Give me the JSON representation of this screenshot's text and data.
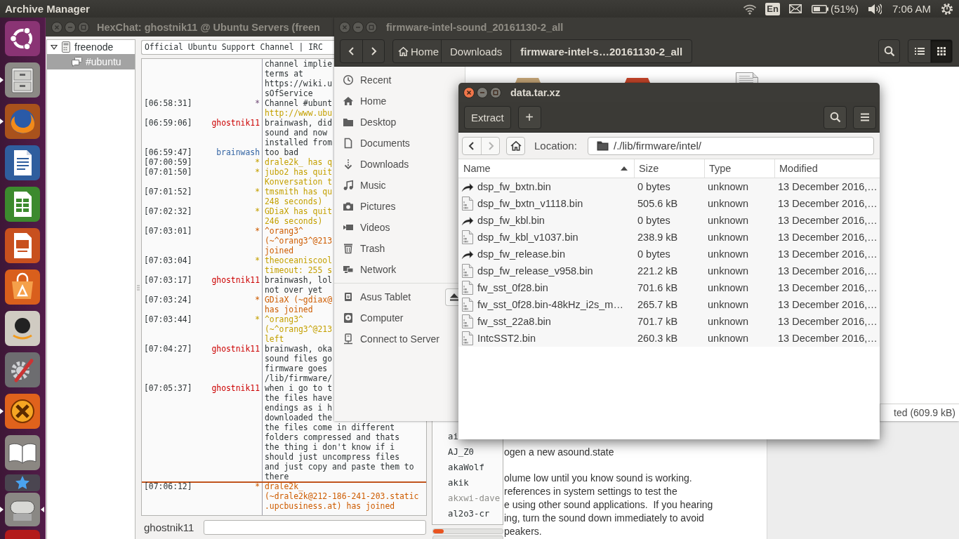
{
  "top_panel": {
    "app_name": "Archive Manager",
    "keyboard_layout": "En",
    "battery": "(51%)",
    "clock": "7:06 AM"
  },
  "launcher": {
    "items": [
      {
        "kind": "dash",
        "running": false,
        "focused": false
      },
      {
        "kind": "files",
        "running": true,
        "focused": false
      },
      {
        "kind": "browser",
        "running": true,
        "focused": false
      },
      {
        "kind": "writer",
        "running": false,
        "focused": false
      },
      {
        "kind": "calc",
        "running": false,
        "focused": false
      },
      {
        "kind": "impress",
        "running": false,
        "focused": false
      },
      {
        "kind": "store",
        "running": false,
        "focused": false
      },
      {
        "kind": "shop",
        "running": false,
        "focused": false
      },
      {
        "kind": "settings",
        "running": false,
        "focused": false
      },
      {
        "kind": "chat",
        "running": true,
        "focused": false
      },
      {
        "kind": "reader",
        "running": false,
        "focused": false
      },
      {
        "kind": "star",
        "running": false,
        "focused": false
      },
      {
        "kind": "roller",
        "running": true,
        "focused": true
      },
      {
        "kind": "red",
        "running": false,
        "focused": false
      }
    ]
  },
  "hexchat": {
    "active": false,
    "title": "HexChat: ghostnik11 @ Ubuntu Servers (freen",
    "tree": [
      {
        "label": "freenode",
        "expanded": true,
        "selected": false,
        "children": [
          {
            "label": "#ubuntu",
            "selected": true
          }
        ]
      }
    ],
    "topic": "Official Ubuntu Support Channel | IRC",
    "messages": [
      {
        "kind": "text",
        "lines": [
          "channel implie",
          "terms at",
          "https://wiki.u",
          "sOfService"
        ]
      },
      {
        "time": "[06:58:31]",
        "nick": "*",
        "kind": "topic",
        "lines": [
          "Channel #ubunt"
        ]
      },
      {
        "kind": "link",
        "lines": [
          "http://www.ubu"
        ]
      },
      {
        "time": "[06:59:06]",
        "nick": "ghostnik11",
        "color": "#cc0000",
        "kind": "text",
        "lines": [
          "brainwash, did",
          "sound and now",
          "installed from"
        ]
      },
      {
        "time": "[06:59:47]",
        "nick": "brainwash",
        "color": "#3465a4",
        "kind": "text",
        "lines": [
          "too bad"
        ]
      },
      {
        "time": "[07:00:59]",
        "nick": "*",
        "kind": "quit",
        "lines": [
          "drale2k_ has q"
        ]
      },
      {
        "time": "[07:01:50]",
        "nick": "*",
        "kind": "quit",
        "lines": [
          "jubo2 has quit",
          "Konversation t"
        ]
      },
      {
        "time": "[07:01:52]",
        "nick": "*",
        "kind": "quit",
        "lines": [
          "tmsmith has qu",
          "248 seconds)"
        ]
      },
      {
        "time": "[07:02:32]",
        "nick": "*",
        "kind": "quit",
        "lines": [
          "GDiaX has quit",
          "246 seconds)"
        ]
      },
      {
        "time": "[07:03:01]",
        "nick": "*",
        "kind": "join",
        "lines": [
          "^orang3^",
          "(~^orang3^@213",
          "joined"
        ]
      },
      {
        "time": "[07:03:04]",
        "nick": "*",
        "kind": "quit",
        "lines": [
          "theoceaniscool",
          "timeout: 255 s"
        ]
      },
      {
        "time": "[07:03:17]",
        "nick": "ghostnik11",
        "color": "#cc0000",
        "kind": "text",
        "lines": [
          "brainwash, lol",
          "not over yet"
        ]
      },
      {
        "time": "[07:03:24]",
        "nick": "*",
        "kind": "join",
        "lines": [
          "GDiaX (~gdiax@",
          "has joined"
        ]
      },
      {
        "time": "[07:03:44]",
        "nick": "*",
        "kind": "part",
        "lines": [
          "^orang3^",
          "(~^orang3^@213",
          "left"
        ]
      },
      {
        "time": "[07:04:27]",
        "nick": "ghostnik11",
        "color": "#cc0000",
        "kind": "text",
        "lines": [
          "brainwash, oka",
          "sound files go",
          "firmware goes",
          "/lib/firmware/"
        ]
      },
      {
        "time": "[07:05:37]",
        "nick": "ghostnik11",
        "color": "#cc0000",
        "kind": "text",
        "lines": [
          "when i go to t",
          "the files have",
          "endings as i h",
          "downloaded the",
          "the files come in different",
          "folders compressed and thats",
          "the thing i don't know if i",
          "should just uncompress files",
          "and just copy and paste them to",
          "there"
        ]
      },
      {
        "kind": "marker"
      },
      {
        "time": "[07:06:12]",
        "nick": "*",
        "kind": "join",
        "lines": [
          "drale2k_",
          "(~drale2k@212-186-241-203.static",
          ".upcbusiness.at) has joined"
        ]
      }
    ],
    "users": [
      {
        "nick": "ai",
        "away": false
      },
      {
        "nick": "AJ_Z0",
        "away": false
      },
      {
        "nick": "akaWolf",
        "away": false
      },
      {
        "nick": "akik",
        "away": false
      },
      {
        "nick": "akxwi-dave",
        "away": true
      },
      {
        "nick": "al2o3-cr",
        "away": false
      }
    ],
    "meters": [
      {
        "level": 0.15
      },
      {
        "level": 0
      }
    ],
    "nick_label": "ghostnik11"
  },
  "document": {
    "paragraphs": [
      [
        "ogen a new asound.state"
      ],
      [
        "olume low until you know sound is working.",
        "references in system settings to test the",
        "e using other sound applications.  If you hearing",
        "ing, turn the sound down immediately to avoid",
        "peakers."
      ]
    ]
  },
  "files": {
    "active": false,
    "title": "firmware-intel-sound_20161130-2_all",
    "breadcrumbs": [
      {
        "kind": "home",
        "label": "Home",
        "selected": false
      },
      {
        "kind": "folder",
        "label": "Downloads",
        "selected": false
      },
      {
        "kind": "folder",
        "label": "firmware-intel-s…20161130-2_all",
        "selected": true
      }
    ],
    "views": [
      {
        "kind": "list",
        "selected": false
      },
      {
        "kind": "grid",
        "selected": true
      }
    ],
    "places": [
      {
        "kind": "recent",
        "label": "Recent"
      },
      {
        "kind": "home",
        "label": "Home"
      },
      {
        "kind": "desktop",
        "label": "Desktop"
      },
      {
        "kind": "documents",
        "label": "Documents"
      },
      {
        "kind": "downloads",
        "label": "Downloads"
      },
      {
        "kind": "music",
        "label": "Music"
      },
      {
        "kind": "pictures",
        "label": "Pictures"
      },
      {
        "kind": "videos",
        "label": "Videos"
      },
      {
        "kind": "trash",
        "label": "Trash"
      },
      {
        "kind": "network",
        "label": "Network"
      }
    ],
    "devices": [
      {
        "kind": "tablet",
        "label": "Asus Tablet",
        "ejectable": true
      },
      {
        "kind": "computer",
        "label": "Computer",
        "ejectable": false
      },
      {
        "kind": "server",
        "label": "Connect to Server",
        "ejectable": false
      }
    ],
    "status": "ted (609.9 kB)"
  },
  "archive": {
    "active": true,
    "title": "data.tar.xz",
    "extract": "Extract",
    "add": "+",
    "nav": [
      {
        "kind": "back",
        "disabled": false
      },
      {
        "kind": "forward",
        "disabled": true
      }
    ],
    "location_label": "Location:",
    "location": "/./lib/firmware/intel/",
    "columns": [
      {
        "label": "Name",
        "sorted": true
      },
      {
        "label": "Size",
        "sorted": false
      },
      {
        "label": "Type",
        "sorted": false
      },
      {
        "label": "Modified",
        "sorted": false
      }
    ],
    "rows": [
      {
        "kind": "link",
        "name": "dsp_fw_bxtn.bin",
        "size": "0 bytes",
        "type": "unknown",
        "modified": "13 December 2016,…"
      },
      {
        "kind": "binary",
        "name": "dsp_fw_bxtn_v1118.bin",
        "size": "505.6 kB",
        "type": "unknown",
        "modified": "13 December 2016,…"
      },
      {
        "kind": "link",
        "name": "dsp_fw_kbl.bin",
        "size": "0 bytes",
        "type": "unknown",
        "modified": "13 December 2016,…"
      },
      {
        "kind": "binary",
        "name": "dsp_fw_kbl_v1037.bin",
        "size": "238.9 kB",
        "type": "unknown",
        "modified": "13 December 2016,…"
      },
      {
        "kind": "link",
        "name": "dsp_fw_release.bin",
        "size": "0 bytes",
        "type": "unknown",
        "modified": "13 December 2016,…"
      },
      {
        "kind": "binary",
        "name": "dsp_fw_release_v958.bin",
        "size": "221.2 kB",
        "type": "unknown",
        "modified": "13 December 2016,…"
      },
      {
        "kind": "binary",
        "name": "fw_sst_0f28.bin",
        "size": "701.6 kB",
        "type": "unknown",
        "modified": "13 December 2016,…"
      },
      {
        "kind": "binary",
        "name": "fw_sst_0f28.bin-48kHz_i2s_m…",
        "size": "265.7 kB",
        "type": "unknown",
        "modified": "13 December 2016,…"
      },
      {
        "kind": "binary",
        "name": "fw_sst_22a8.bin",
        "size": "701.7 kB",
        "type": "unknown",
        "modified": "13 December 2016,…"
      },
      {
        "kind": "binary",
        "name": "IntcSST2.bin",
        "size": "260.3 kB",
        "type": "unknown",
        "modified": "13 December 2016,…"
      }
    ]
  }
}
